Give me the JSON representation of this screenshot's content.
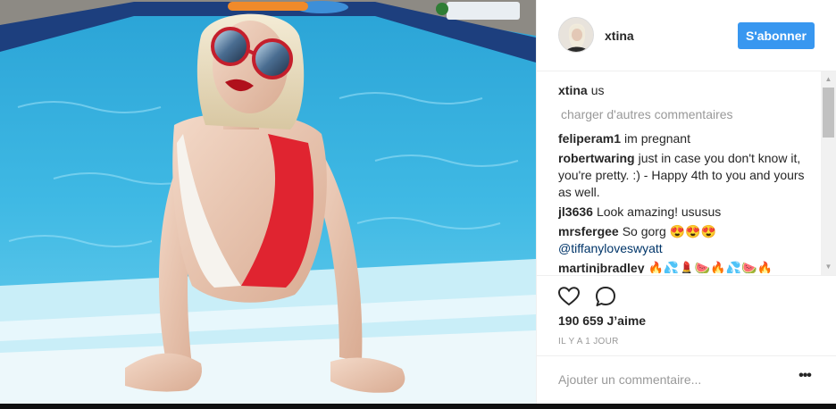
{
  "post": {
    "username": "xtina",
    "follow_label": "S'abonner",
    "caption": {
      "user": "xtina",
      "text": "us"
    },
    "load_more": "charger d'autres commentaires",
    "comments": [
      {
        "user": "feliperam1",
        "text": "im pregnant"
      },
      {
        "user": "robertwaring",
        "text": "just in case you don't know it, you're pretty. :) - Happy 4th to you and yours as well."
      },
      {
        "user": "jl3636",
        "text": "Look amazing! ususus"
      },
      {
        "user": "mrsfergee",
        "text": "So gorg 😍😍😍",
        "mention": "@tiffanyloveswyatt"
      },
      {
        "user": "martinjbradley",
        "text": "🔥💦💄🍉🔥💦🍉🔥"
      }
    ],
    "likes": "190 659 J’aime",
    "time": "IL Y A 1 JOUR",
    "comment_placeholder": "Ajouter un commentaire...",
    "more_label": "•••",
    "icons": {
      "like": "heart-icon",
      "comment": "speech-bubble-icon",
      "more": "more-options-icon",
      "scroll_up": "chevron-up-icon",
      "scroll_down": "chevron-down-icon"
    },
    "colors": {
      "follow_button": "#3897f0",
      "mention": "#003569",
      "muted": "#999999"
    }
  }
}
